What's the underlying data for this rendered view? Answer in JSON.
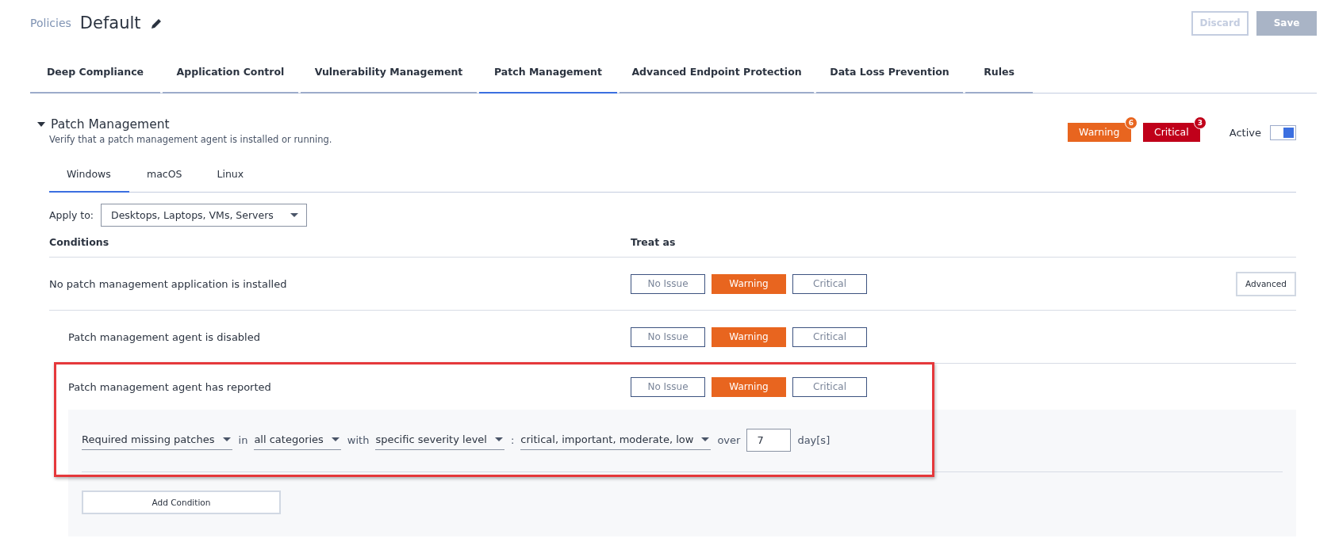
{
  "breadcrumb": "Policies",
  "title": "Default",
  "actions": [
    {
      "label": "Discard",
      "kind": "outline",
      "disabled": true
    },
    {
      "label": "Save",
      "kind": "filled",
      "disabled": true
    }
  ],
  "tabs": [
    {
      "label": "Deep Compliance",
      "selected": false
    },
    {
      "label": "Application Control",
      "selected": false
    },
    {
      "label": "Vulnerability Management",
      "selected": false
    },
    {
      "label": "Patch Management",
      "selected": true
    },
    {
      "label": "Advanced Endpoint Protection",
      "selected": false
    },
    {
      "label": "Data Loss Prevention",
      "selected": false
    },
    {
      "label": "Rules",
      "selected": false
    }
  ],
  "section": {
    "title": "Patch Management",
    "expanded": true,
    "description": "Verify that a patch management agent is installed or running.",
    "badges": [
      {
        "label": "Warning",
        "count": "6",
        "color": "#e8651f"
      },
      {
        "label": "Critical",
        "count": "3",
        "color": "#c0001a"
      }
    ],
    "active_label": "Active",
    "active_on": true
  },
  "os_tabs": [
    {
      "label": "Windows",
      "selected": true
    },
    {
      "label": "macOS",
      "selected": false
    },
    {
      "label": "Linux",
      "selected": false
    }
  ],
  "apply_to": {
    "label": "Apply to:",
    "value": "Desktops, Laptops, VMs, Servers"
  },
  "columns": [
    "Conditions",
    "Treat as"
  ],
  "conditions": [
    {
      "text": "No patch management application is installed",
      "advanced": "Advanced",
      "options": [
        {
          "label": "No Issue",
          "selected": false
        },
        {
          "label": "Warning",
          "selected": true
        },
        {
          "label": "Critical",
          "selected": false
        }
      ],
      "children": [
        {
          "text": "Patch management agent is disabled",
          "options": [
            {
              "label": "No Issue",
              "selected": false
            },
            {
              "label": "Warning",
              "selected": true
            },
            {
              "label": "Critical",
              "selected": false
            }
          ]
        },
        {
          "text": "Patch management agent has reported",
          "highlighted": true,
          "options": [
            {
              "label": "No Issue",
              "selected": false
            },
            {
              "label": "Warning",
              "selected": true
            },
            {
              "label": "Critical",
              "selected": false
            }
          ],
          "details": [
            {
              "kind": "dropdown",
              "text": "Required missing patches"
            },
            {
              "kind": "word",
              "text": "in"
            },
            {
              "kind": "dropdown",
              "text": "all categories"
            },
            {
              "kind": "word",
              "text": "with"
            },
            {
              "kind": "dropdown",
              "text": "specific severity level"
            },
            {
              "kind": "word",
              "text": ":"
            },
            {
              "kind": "dropdown",
              "text": "critical, important, moderate, low"
            },
            {
              "kind": "word",
              "text": "over"
            },
            {
              "kind": "number",
              "text": "7"
            },
            {
              "kind": "word",
              "text": "day[s]"
            }
          ],
          "add_button": "Add Condition"
        }
      ]
    }
  ]
}
